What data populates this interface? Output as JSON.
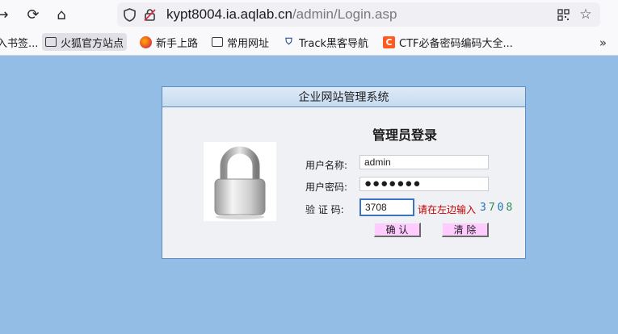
{
  "browser": {
    "url_host": "kypt8004.ia.aqlab.cn",
    "url_path": "/admin/Login.asp",
    "bookmarks": [
      {
        "label": "入书签...",
        "icon": "none"
      },
      {
        "label": "火狐官方站点",
        "icon": "folder-icon"
      },
      {
        "label": "新手上路",
        "icon": "firefox-icon"
      },
      {
        "label": "常用网址",
        "icon": "folder-icon"
      },
      {
        "label": "Track黑客导航",
        "icon": "shield-icon"
      },
      {
        "label": "CTF必备密码编码大全...",
        "icon": "c-icon"
      }
    ],
    "more": "»"
  },
  "panel": {
    "header": "企业网站管理系统",
    "title": "管理员登录",
    "username_label": "用户名称:",
    "username_value": "admin",
    "password_label": "用户密码:",
    "password_value": "●●●●●●●",
    "captcha_label": "验 证 码:",
    "captcha_value": "3708",
    "captcha_hint": "请在左边输入",
    "captcha_digits": [
      {
        "d": "3",
        "color": "#1d6fb8"
      },
      {
        "d": "7",
        "color": "#2e8b57"
      },
      {
        "d": "0",
        "color": "#1d6fb8"
      },
      {
        "d": "8",
        "color": "#2e8b57"
      }
    ],
    "confirm_label": "确 认",
    "clear_label": "清 除"
  }
}
